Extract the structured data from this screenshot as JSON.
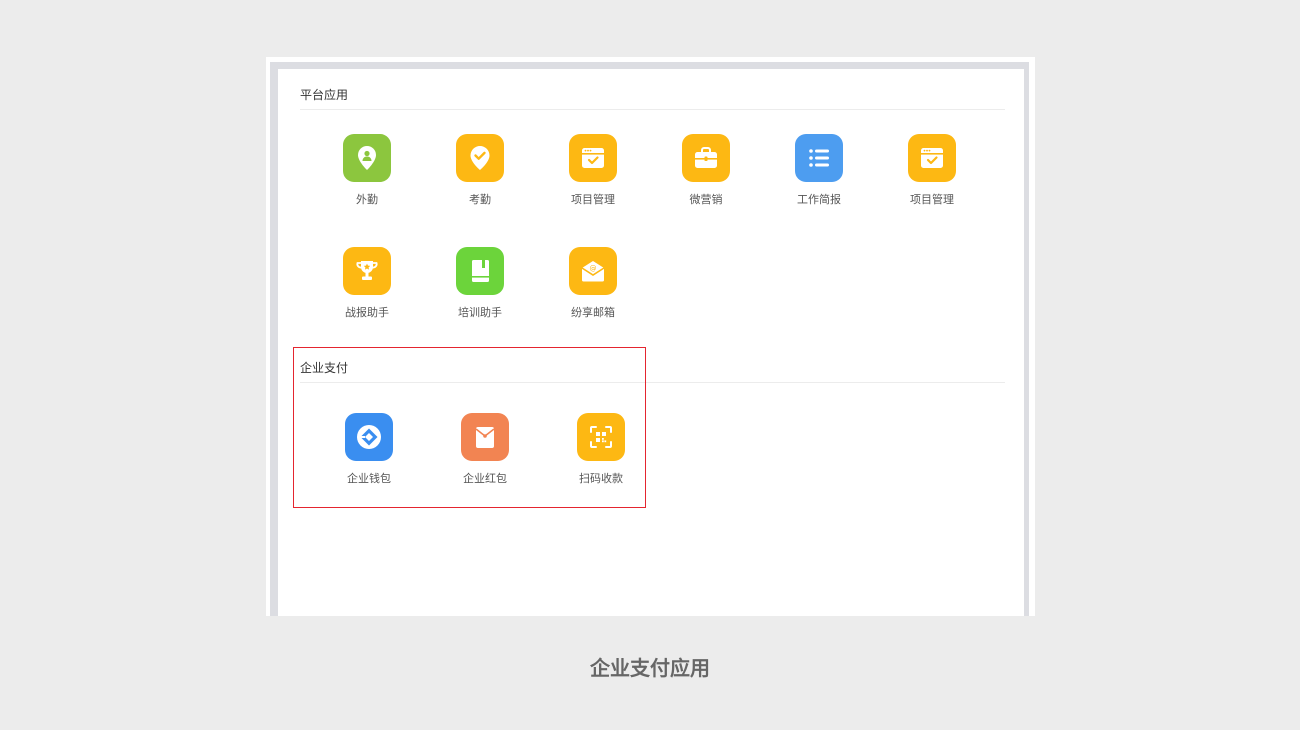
{
  "sections": {
    "platform": {
      "title": "平台应用"
    },
    "payment": {
      "title": "企业支付"
    }
  },
  "platform_apps": [
    {
      "label": "外勤",
      "icon": "location-person-icon",
      "color": "#8cc63e"
    },
    {
      "label": "考勤",
      "icon": "checkmark-pin-icon",
      "color": "#fdb813"
    },
    {
      "label": "项目管理",
      "icon": "calendar-check-icon",
      "color": "#fdb813"
    },
    {
      "label": "微营销",
      "icon": "briefcase-icon",
      "color": "#fdb813"
    },
    {
      "label": "工作简报",
      "icon": "list-icon",
      "color": "#4d9df0"
    },
    {
      "label": "项目管理",
      "icon": "calendar-check-icon",
      "color": "#fdb813"
    },
    {
      "label": "战报助手",
      "icon": "trophy-icon",
      "color": "#fdb813"
    },
    {
      "label": "培训助手",
      "icon": "book-icon",
      "color": "#6cd43b"
    },
    {
      "label": "纷享邮箱",
      "icon": "mail-icon",
      "color": "#fdb813"
    }
  ],
  "payment_apps": [
    {
      "label": "企业钱包",
      "icon": "wallet-icon",
      "color": "#3a8ef0"
    },
    {
      "label": "企业红包",
      "icon": "red-envelope-icon",
      "color": "#f28452"
    },
    {
      "label": "扫码收款",
      "icon": "qr-scan-icon",
      "color": "#fdb813"
    }
  ],
  "caption": "企业支付应用",
  "colors": {
    "highlight": "#e4252f",
    "background": "#ececec"
  }
}
